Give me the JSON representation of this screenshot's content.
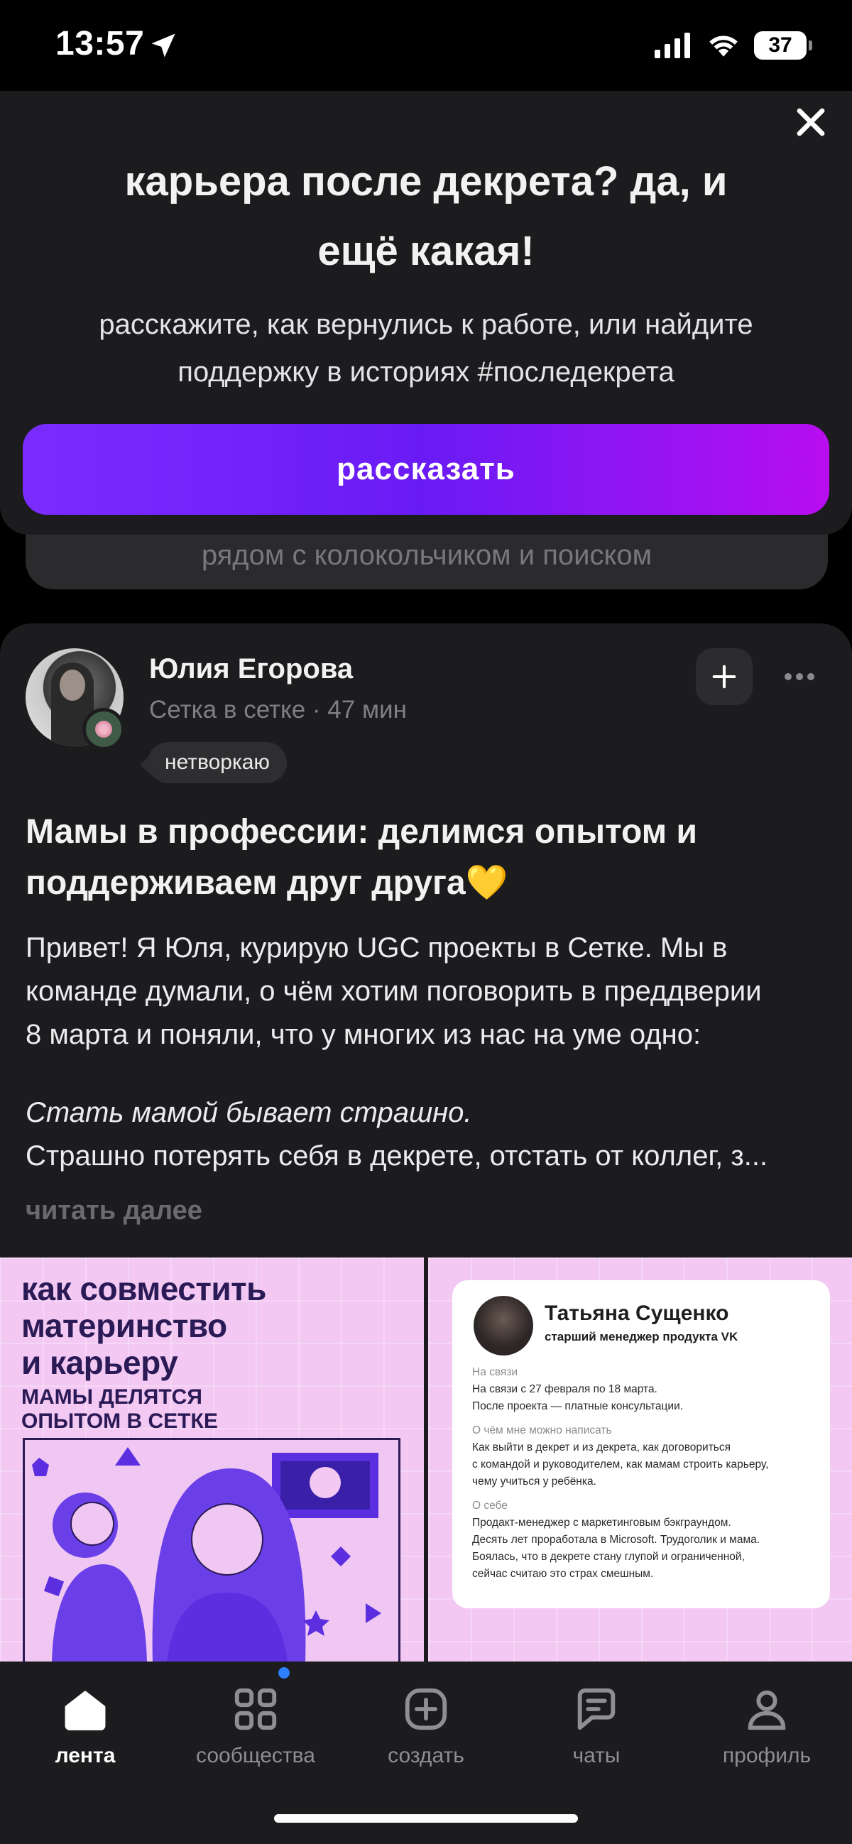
{
  "status_bar": {
    "time": "13:57",
    "battery": "37"
  },
  "hint_card": {
    "text": "рядом с колокольчиком и поиском"
  },
  "banner": {
    "title_line1": "карьера после декрета? да, и",
    "title_line2": "ещё какая!",
    "subtitle_line1": "расскажите, как вернулись к работе, или найдите",
    "subtitle_line2": "поддержку в историях #последекрета",
    "cta_label": "рассказать"
  },
  "post": {
    "author": "Юлия Егорова",
    "meta": "Сетка в сетке · 47 мин",
    "tag": "нетворкаю",
    "title_line1": "Мамы в профессии: делимся опытом и",
    "title_line2": "поддерживаем друг друга💛",
    "body_line1": "Привет! Я Юля, курирую UGC проекты в Сетке. Мы в",
    "body_line2": "команде думали, о чём хотим поговорить в преддверии",
    "body_line3": "8 марта и поняли, что у многих из нас на уме одно:",
    "italic": "Стать мамой бывает страшно.",
    "truncated": "Страшно потерять себя в декрете, отстать от коллег, з...",
    "read_more": "читать далее"
  },
  "image1": {
    "heading_l1": "как совместить",
    "heading_l2": "материнство",
    "heading_l3": "и карьеру",
    "sub_l1": "МАМЫ ДЕЛЯТСЯ",
    "sub_l2": "ОПЫТОМ В СЕТКЕ"
  },
  "image2": {
    "name": "Татьяна Сущенко",
    "role": "старший менеджер продукта VK",
    "b1_label": "На связи",
    "b1_l1": "На связи с 27 февраля по 18 марта.",
    "b1_l2": "После проекта — платные консультации.",
    "b2_label": "О чём мне можно написать",
    "b2_l1": "Как выйти в декрет и из декрета, как договориться",
    "b2_l2": "с командой и руководителем, как мамам строить карьеру,",
    "b2_l3": "чему учиться у ребёнка.",
    "b3_label": "О себе",
    "b3_l1": "Продакт-менеджер с маркетинговым бэкграундом.",
    "b3_l2": "Десять лет проработала в Microsoft. Трудоголик и мама.",
    "b3_l3": "Боялась, что в декрете стану глупой и ограниченной,",
    "b3_l4": "сейчас считаю это страх смешным."
  },
  "nav": {
    "items": [
      {
        "label": "лента",
        "icon": "home-icon"
      },
      {
        "label": "сообщества",
        "icon": "grid-icon"
      },
      {
        "label": "создать",
        "icon": "plus-square-icon"
      },
      {
        "label": "чаты",
        "icon": "chat-icon"
      },
      {
        "label": "профиль",
        "icon": "person-icon"
      }
    ]
  },
  "colors": {
    "accent_start": "#7a2cff",
    "accent_end": "#b80ef0",
    "surface": "#1c1c1e",
    "notification_dot": "#2f80ff"
  }
}
